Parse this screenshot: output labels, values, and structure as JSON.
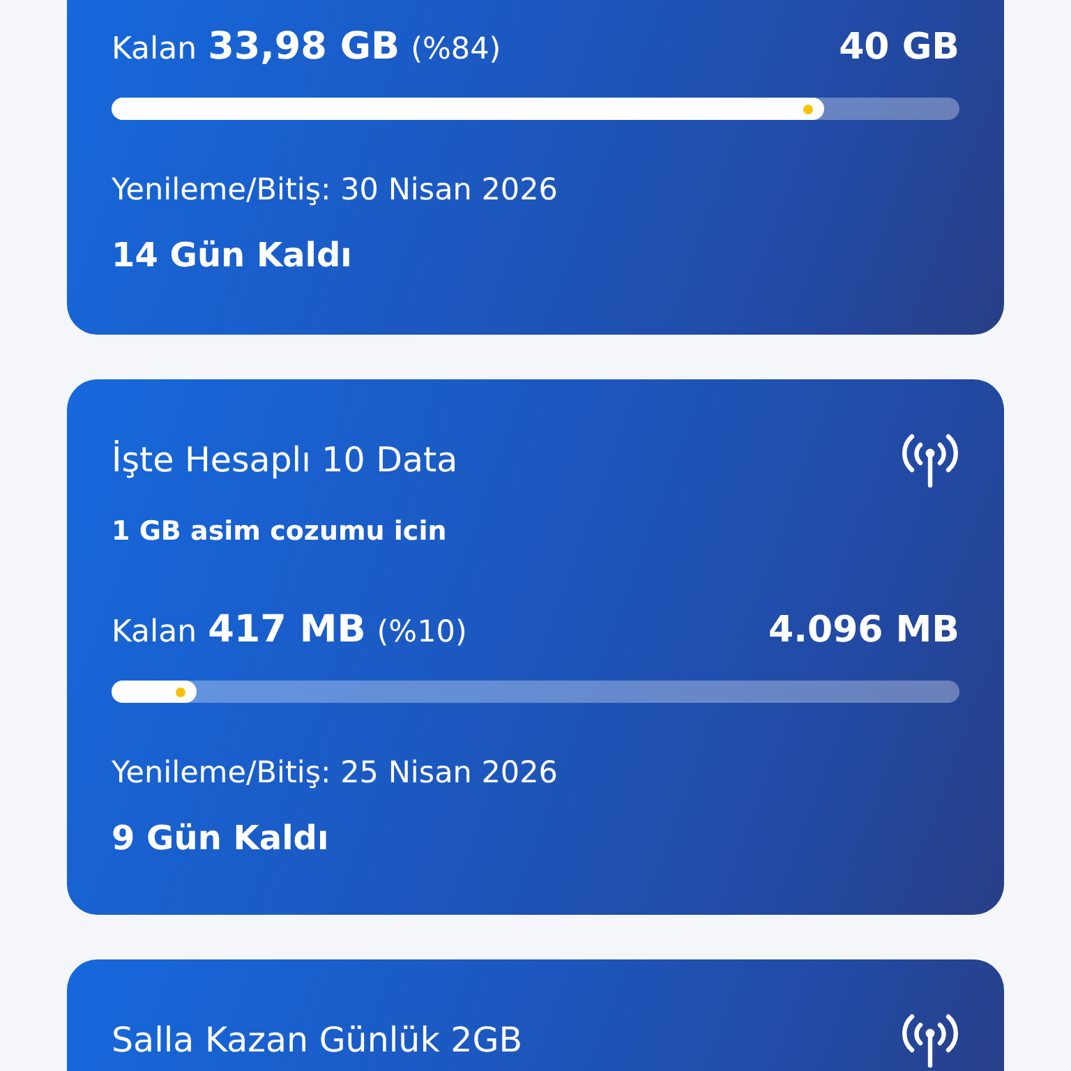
{
  "packages": [
    {
      "remaining_label": "Kalan",
      "remaining": "33,98 GB",
      "percent": "(%84)",
      "total": "40 GB",
      "level": 0.84,
      "renewal": "Yenileme/Bitiş: 30 Nisan 2026",
      "days_left": "14 Gün Kaldı"
    },
    {
      "title": "İşte Hesaplı 10 Data",
      "subtitle": "1 GB asim cozumu icin",
      "remaining_label": "Kalan",
      "remaining": "417 MB",
      "percent": "(%10)",
      "total": "4.096 MB",
      "level": 0.1,
      "renewal": "Yenileme/Bitiş: 25 Nisan 2026",
      "days_left": "9 Gün Kaldı"
    },
    {
      "title": "Salla Kazan Günlük 2GB"
    }
  ]
}
